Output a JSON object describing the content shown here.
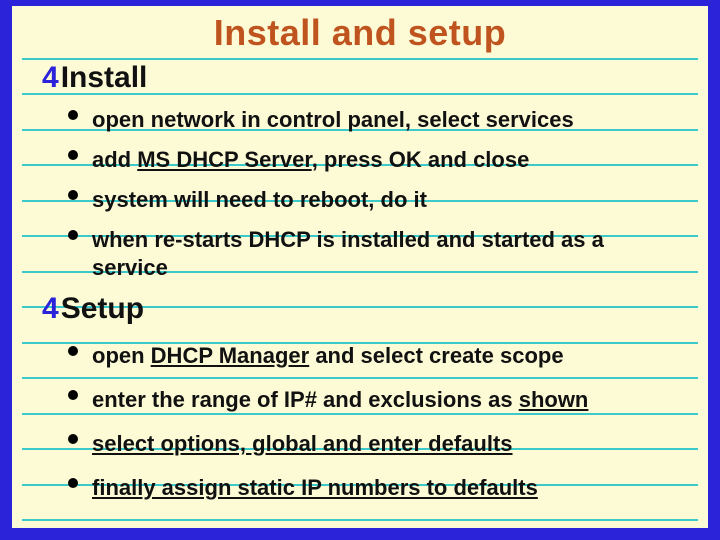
{
  "title": "Install and setup",
  "sections": {
    "install": {
      "heading": "Install",
      "items": [
        {
          "plain": "open network in control panel, select services"
        },
        {
          "pre": "add ",
          "underlined": "MS DHCP Server",
          "post": ", press OK and close"
        },
        {
          "plain": "system will need to reboot, do it"
        },
        {
          "plain": "when re-starts DHCP is installed and started as a service"
        }
      ]
    },
    "setup": {
      "heading": "Setup",
      "items": [
        {
          "pre": "open ",
          "underlined": "DHCP Manager",
          "post": " and select create scope"
        },
        {
          "pre": "enter the range of IP# and exclusions as ",
          "underlined": "shown",
          "post": ""
        },
        {
          "underlined_full": "select options, global and enter defaults"
        },
        {
          "underlined_full": "finally assign static IP numbers to defaults"
        }
      ]
    }
  },
  "check_glyph": "4"
}
